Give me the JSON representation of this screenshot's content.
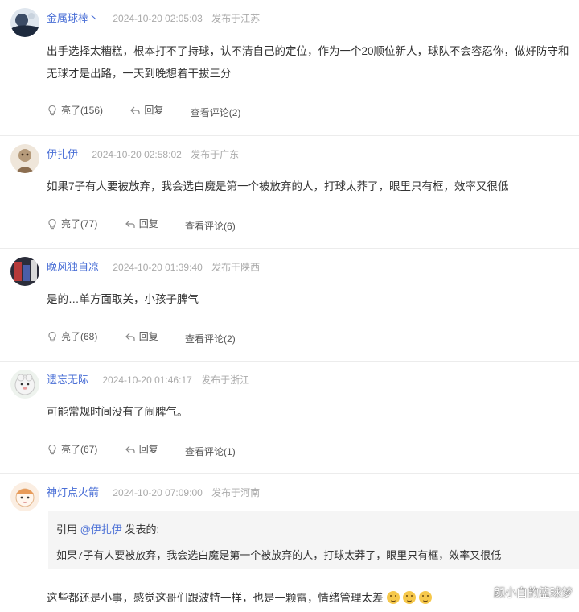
{
  "comments": [
    {
      "user": "金属球棒丶",
      "time": "2024-10-20 02:05:03",
      "location": "发布于江苏",
      "text": "出手选择太糟糕，根本打不了持球，认不清自己的定位，作为一个20顺位新人，球队不会容忍你，做好防守和无球才是出路，一天到晚想着干拔三分",
      "like_label": "亮了(156)",
      "reply_label": "回复",
      "view_label": "查看评论(2)"
    },
    {
      "user": "伊扎伊",
      "time": "2024-10-20 02:58:02",
      "location": "发布于广东",
      "text": "如果7子有人要被放弃，我会选白魔是第一个被放弃的人，打球太莽了，眼里只有框，效率又很低",
      "like_label": "亮了(77)",
      "reply_label": "回复",
      "view_label": "查看评论(6)"
    },
    {
      "user": "晚风独自凉",
      "time": "2024-10-20 01:39:40",
      "location": "发布于陕西",
      "text": "是的…单方面取关，小孩子脾气",
      "like_label": "亮了(68)",
      "reply_label": "回复",
      "view_label": "查看评论(2)"
    },
    {
      "user": "遗忘无际",
      "time": "2024-10-20 01:46:17",
      "location": "发布于浙江",
      "text": "可能常规时间没有了闹脾气。",
      "like_label": "亮了(67)",
      "reply_label": "回复",
      "view_label": "查看评论(1)"
    },
    {
      "user": "神灯点火箭",
      "time": "2024-10-20 07:09:00",
      "location": "发布于河南",
      "quote_prefix": "引用 ",
      "quote_user": "@伊扎伊",
      "quote_suffix": " 发表的:",
      "quote_text": "如果7子有人要被放弃，我会选白魔是第一个被放弃的人，打球太莽了，眼里只有框，效率又很低",
      "text": "这些都还是小事，感觉这哥们跟波特一样，也是一颗雷，情绪管理太差"
    }
  ],
  "watermark": "颜小白的篮球梦",
  "colors": {
    "username": "#4a6fd6",
    "meta": "#aaaaaa",
    "quote_bg": "#f5f5f5"
  }
}
